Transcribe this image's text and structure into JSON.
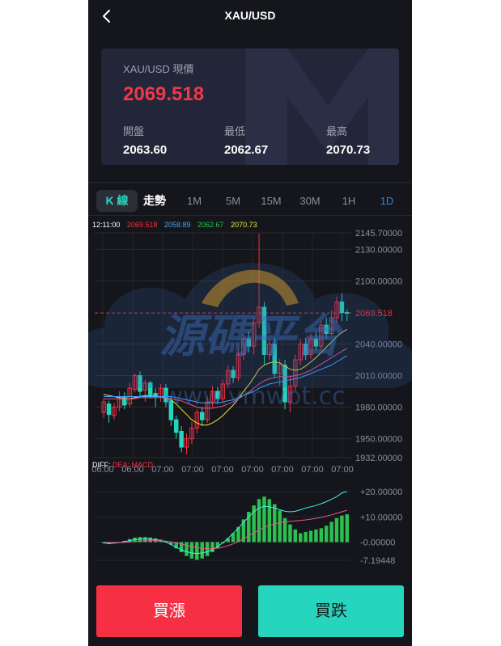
{
  "header": {
    "title": "XAU/USD"
  },
  "quote": {
    "label": "XAU/USD 現價",
    "price": "2069.518",
    "open_label": "開盤",
    "open": "2063.60",
    "low_label": "最低",
    "low": "2062.67",
    "high_label": "最高",
    "high": "2070.73"
  },
  "tabs": {
    "kline": "K 線",
    "trend": "走勢",
    "intervals": [
      "1M",
      "5M",
      "15M",
      "30M",
      "1H",
      "1D"
    ],
    "active_interval": "1D"
  },
  "legend": {
    "time": "12:11:00",
    "close": "2069.518",
    "ma_blue": "2058.89",
    "ma_green": "2062.67",
    "ma_yellow": "2070.73",
    "diff_label": "DIFF:",
    "diff_rest": "DEA: MACD"
  },
  "watermark": {
    "text": "源碼平台",
    "url": "www.ymwpt.cc"
  },
  "buttons": {
    "buy_up": "買漲",
    "buy_down": "買跌"
  },
  "colors": {
    "up": "#f72f44",
    "down": "#27d5bf",
    "price": "#f0384b",
    "accent": "#2f7ff0",
    "macd_bar": "#2bc04f"
  },
  "chart_data": [
    {
      "type": "candlestick",
      "title": "",
      "ylim": [
        1932.0,
        2145.7
      ],
      "y_ticks": [
        "2145.70000",
        "2130.00000",
        "2100.00000",
        "2069.518",
        "2040.00000",
        "2010.00000",
        "1980.00000",
        "1950.00000",
        "1932.00000"
      ],
      "x_ticks": [
        "06:00",
        "06:00",
        "07:00",
        "07:00",
        "07:00",
        "07:00",
        "07:00",
        "07:00",
        "07:00"
      ],
      "last_price_line": 2069.518,
      "candles": [
        [
          1975,
          1985,
          1970,
          1988
        ],
        [
          1983,
          1973,
          1965,
          1986
        ],
        [
          1972,
          1980,
          1968,
          1984
        ],
        [
          1980,
          1990,
          1976,
          1995
        ],
        [
          1990,
          1982,
          1978,
          1994
        ],
        [
          1983,
          1998,
          1980,
          2003
        ],
        [
          1997,
          2010,
          1994,
          2012
        ],
        [
          2010,
          1995,
          1990,
          2014
        ],
        [
          1996,
          2003,
          1985,
          2006
        ],
        [
          2003,
          1992,
          1988,
          2005
        ],
        [
          1993,
          1990,
          1980,
          1998
        ],
        [
          1990,
          1998,
          1985,
          2002
        ],
        [
          1998,
          1985,
          1980,
          2002
        ],
        [
          1986,
          1968,
          1962,
          1990
        ],
        [
          1968,
          1956,
          1950,
          1972
        ],
        [
          1957,
          1942,
          1937,
          1962
        ],
        [
          1942,
          1950,
          1935,
          1955
        ],
        [
          1950,
          1960,
          1945,
          1966
        ],
        [
          1960,
          1975,
          1955,
          1978
        ],
        [
          1975,
          1968,
          1962,
          1980
        ],
        [
          1968,
          1985,
          1965,
          1990
        ],
        [
          1985,
          1995,
          1980,
          2000
        ],
        [
          1995,
          1988,
          1983,
          1999
        ],
        [
          1988,
          2002,
          1985,
          2006
        ],
        [
          2002,
          2015,
          1998,
          2020
        ],
        [
          2015,
          2008,
          2003,
          2019
        ],
        [
          2008,
          2030,
          2005,
          2034
        ],
        [
          2030,
          2045,
          2025,
          2050
        ],
        [
          2045,
          2038,
          2032,
          2052
        ],
        [
          2038,
          2060,
          2030,
          2065
        ],
        [
          2060,
          2075,
          2055,
          2145
        ],
        [
          2075,
          2030,
          2020,
          2080
        ],
        [
          2030,
          2040,
          2025,
          2045
        ],
        [
          2040,
          2012,
          2008,
          2046
        ],
        [
          2012,
          2020,
          2000,
          2026
        ],
        [
          2020,
          1985,
          1978,
          2025
        ],
        [
          1985,
          2000,
          1975,
          2010
        ],
        [
          2000,
          2025,
          1995,
          2030
        ],
        [
          2025,
          2040,
          2020,
          2045
        ],
        [
          2040,
          2030,
          2025,
          2046
        ],
        [
          2030,
          2045,
          2026,
          2050
        ],
        [
          2045,
          2038,
          2034,
          2052
        ],
        [
          2038,
          2058,
          2035,
          2062
        ],
        [
          2058,
          2050,
          2045,
          2065
        ],
        [
          2050,
          2065,
          2048,
          2072
        ],
        [
          2065,
          2080,
          2060,
          2085
        ],
        [
          2080,
          2070,
          2062,
          2088
        ],
        [
          2070,
          2069.518,
          2062,
          2073
        ]
      ],
      "ma_series": [
        {
          "color": "#e6e636",
          "values": [
            1992,
            1991,
            1990,
            1989,
            1988,
            1988,
            1989,
            1990,
            1991,
            1991,
            1990,
            1990,
            1989,
            1987,
            1983,
            1978,
            1973,
            1968,
            1965,
            1963,
            1963,
            1965,
            1968,
            1972,
            1977,
            1982,
            1988,
            1995,
            2001,
            2008,
            2016,
            2020,
            2022,
            2023,
            2022,
            2019,
            2016,
            2015,
            2016,
            2019,
            2023,
            2027,
            2032,
            2037,
            2042,
            2047,
            2051,
            2054
          ]
        },
        {
          "color": "#e7568a",
          "values": [
            1988,
            1988,
            1988,
            1988,
            1988,
            1988,
            1988,
            1989,
            1989,
            1989,
            1989,
            1989,
            1989,
            1988,
            1987,
            1986,
            1984,
            1982,
            1980,
            1979,
            1979,
            1979,
            1980,
            1981,
            1983,
            1985,
            1988,
            1991,
            1994,
            1998,
            2002,
            2005,
            2007,
            2008,
            2009,
            2009,
            2009,
            2010,
            2011,
            2013,
            2015,
            2018,
            2021,
            2024,
            2027,
            2030,
            2033,
            2036
          ]
        },
        {
          "color": "#3fa6ff",
          "values": [
            1990,
            1990,
            1990,
            1990,
            1990,
            1990,
            1990,
            1990,
            1990,
            1990,
            1990,
            1990,
            1990,
            1990,
            1989,
            1988,
            1987,
            1986,
            1985,
            1984,
            1984,
            1984,
            1984,
            1985,
            1986,
            1987,
            1989,
            1991,
            1993,
            1995,
            1998,
            2000,
            2002,
            2003,
            2004,
            2005,
            2006,
            2007,
            2008,
            2010,
            2012,
            2014,
            2016,
            2018,
            2020,
            2023,
            2026,
            2029
          ]
        }
      ]
    },
    {
      "type": "bar",
      "title": "MACD",
      "ylim": [
        -7.19448,
        20.0
      ],
      "y_ticks": [
        "+20.00000",
        "+10.00000",
        "-0.00000",
        "-7.19448"
      ],
      "values": [
        -0.5,
        -0.8,
        -0.5,
        -0.2,
        0.5,
        1.2,
        1.8,
        2.0,
        2.0,
        1.8,
        1.5,
        1.0,
        0.2,
        -1.0,
        -2.5,
        -4.0,
        -5.5,
        -6.5,
        -7.0,
        -6.5,
        -5.5,
        -4.0,
        -2.5,
        -0.5,
        1.5,
        3.5,
        6.0,
        9.0,
        12.0,
        14.5,
        17.0,
        18.0,
        17.0,
        15.0,
        12.5,
        9.5,
        7.0,
        5.0,
        3.5,
        4.0,
        4.5,
        5.0,
        5.5,
        6.5,
        8.0,
        9.5,
        10.5,
        11.0
      ],
      "series": [
        {
          "color": "#40f0f0",
          "values": [
            -0.3,
            -0.5,
            -0.4,
            -0.2,
            0.2,
            0.6,
            1.0,
            1.2,
            1.3,
            1.2,
            1.0,
            0.6,
            0.0,
            -1.0,
            -2.0,
            -3.0,
            -3.8,
            -4.3,
            -4.5,
            -4.3,
            -3.8,
            -3.0,
            -1.8,
            -0.3,
            1.5,
            3.5,
            5.5,
            7.8,
            10.0,
            12.0,
            13.5,
            14.2,
            14.0,
            13.5,
            12.8,
            12.2,
            12.0,
            12.2,
            12.8,
            13.5,
            14.0,
            14.5,
            15.2,
            16.0,
            17.0,
            18.0,
            19.5,
            20.0
          ]
        },
        {
          "color": "#e7568a",
          "values": [
            -0.1,
            -0.2,
            -0.2,
            -0.2,
            -0.1,
            0.0,
            0.2,
            0.4,
            0.5,
            0.6,
            0.6,
            0.5,
            0.4,
            0.1,
            -0.3,
            -0.8,
            -1.3,
            -1.8,
            -2.2,
            -2.5,
            -2.6,
            -2.6,
            -2.4,
            -2.0,
            -1.4,
            -0.7,
            0.2,
            1.3,
            2.5,
            3.7,
            4.8,
            5.8,
            6.6,
            7.2,
            7.7,
            8.0,
            8.2,
            8.4,
            8.6,
            8.8,
            9.1,
            9.4,
            9.8,
            10.3,
            10.8,
            11.4,
            12.0,
            12.6
          ]
        }
      ]
    }
  ]
}
